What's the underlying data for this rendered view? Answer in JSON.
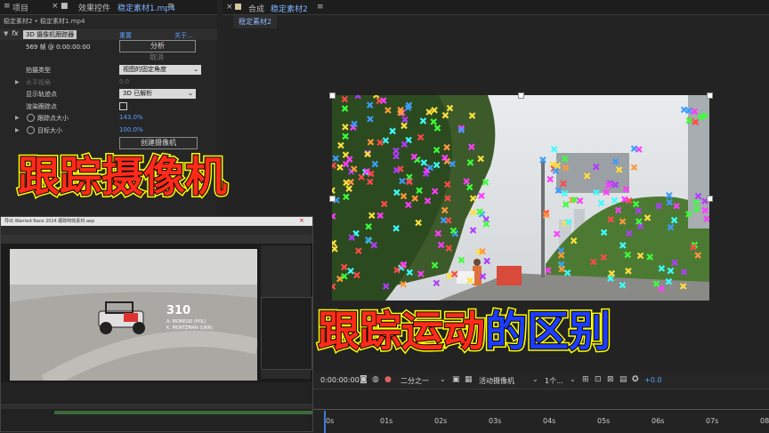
{
  "effects_panel": {
    "tabs": {
      "project": "项目",
      "effect_controls_prefix": "效果控件",
      "effect_controls_file": "稳定素材1.mp4"
    },
    "breadcrumb": "稳定素材2 • 稳定素材1.mp4",
    "effect": {
      "name": "3D 摄像机跟踪器",
      "reset": "重置",
      "about": "关于..."
    },
    "frame_info": "569 帧 @ 0:00:00:00",
    "analyze_button": "分析",
    "cancel_button": "取消",
    "properties": [
      {
        "label": "拍摄类型",
        "value": "视图的固定角度",
        "type": "dropdown"
      },
      {
        "label": "水平视角",
        "value": "0.0",
        "type": "disabled"
      },
      {
        "label": "显示轨迹点",
        "value": "3D 已解析",
        "type": "dropdown"
      },
      {
        "label": "渲染跟踪点",
        "value": "",
        "type": "checkbox"
      },
      {
        "label": "跟踪点大小",
        "value": "143.0%",
        "type": "number"
      },
      {
        "label": "目标大小",
        "value": "100.0%",
        "type": "number"
      }
    ],
    "create_camera_button": "创建摄像机"
  },
  "composition": {
    "tab_prefix": "合成",
    "tab_name": "稳定素材2",
    "sub_tab": "稳定素材2"
  },
  "viewer_toolbar": {
    "timecode": "0:00:00:00",
    "resolution": "二分之一",
    "camera": "活动摄像机",
    "views": "1个...",
    "exposure": "+0.0"
  },
  "timeline": {
    "ticks": [
      "0s",
      "01s",
      "02s",
      "03s",
      "04s",
      "05s",
      "06s",
      "07s",
      "08s"
    ]
  },
  "inset": {
    "title": "导出 Wanted Race 2024 跟踪特效素材.aep",
    "car_number": "310",
    "car_caption_1": "A. MORESKI (POL)",
    "car_caption_2": "K. MORTZMAN (UKR)"
  },
  "captions": {
    "camera_tracking": "跟踪摄像机",
    "motion_tracking_part1": "跟踪运动",
    "motion_tracking_part2": "的区别"
  },
  "colors": {
    "caption_fill": "#ffff00",
    "caption_red": "#ff2a1a",
    "caption_blue": "#1e3cff",
    "link_blue": "#5aa0ff"
  }
}
